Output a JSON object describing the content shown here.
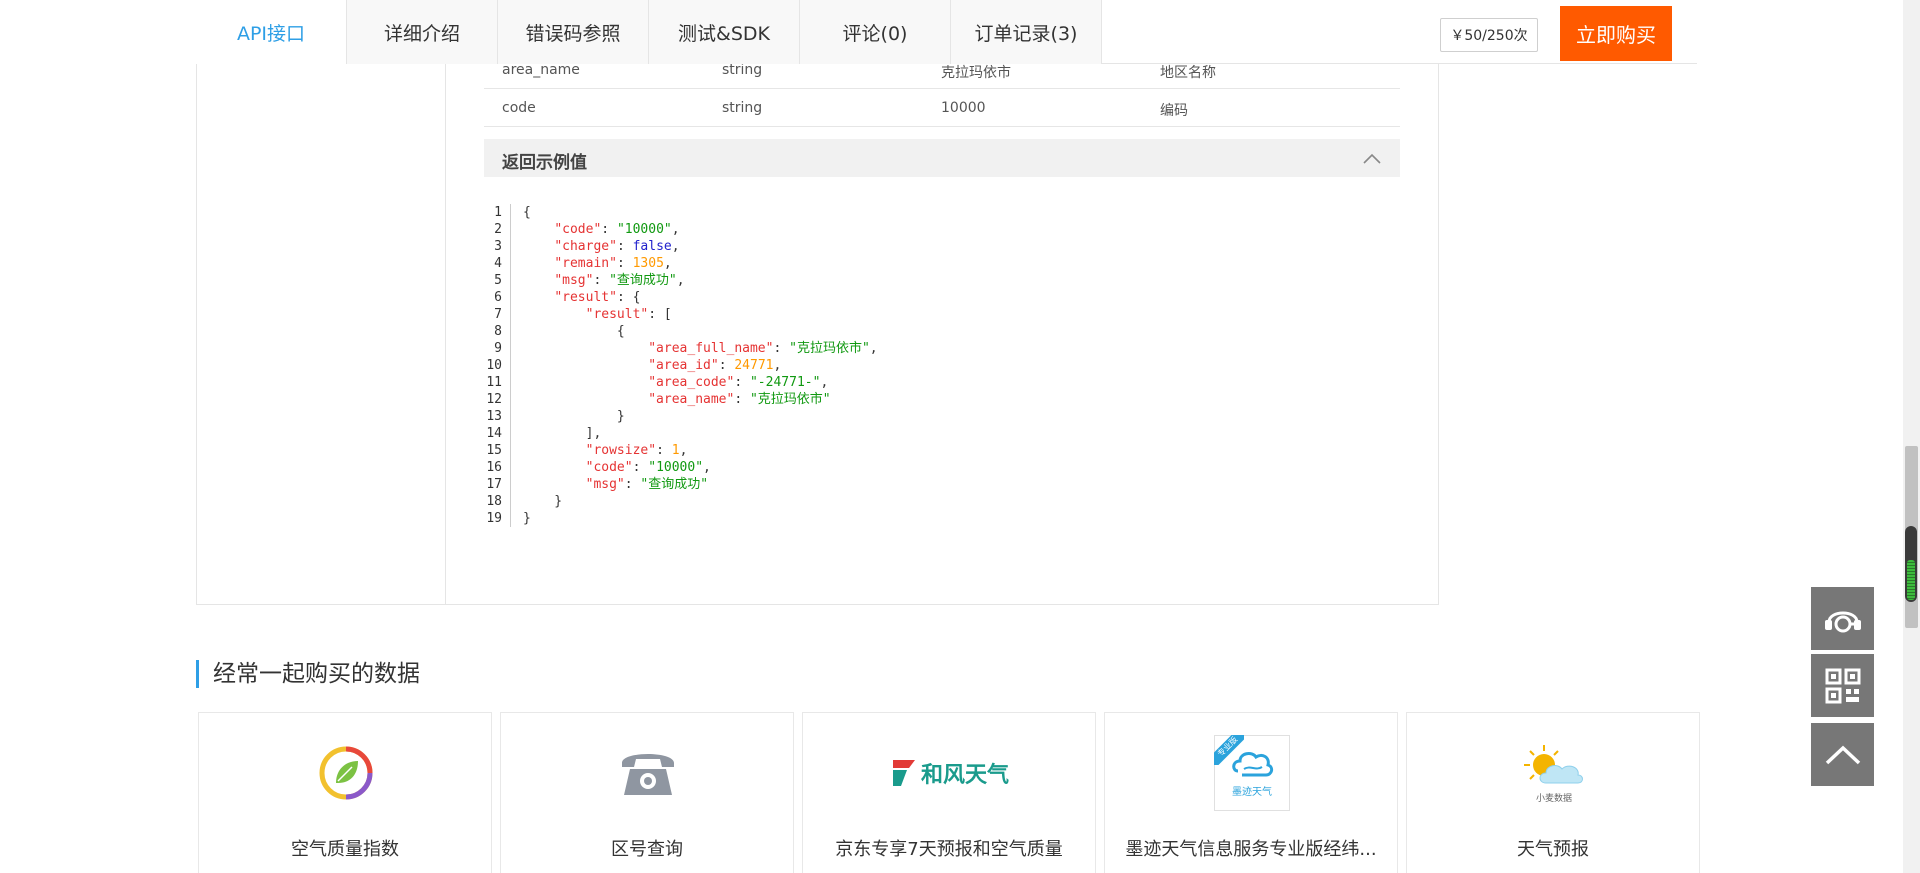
{
  "tabs": [
    {
      "label": "API接口",
      "active": true
    },
    {
      "label": "详细介绍",
      "active": false
    },
    {
      "label": "错误码参照",
      "active": false
    },
    {
      "label": "测试&SDK",
      "active": false
    },
    {
      "label": "评论(0)",
      "active": false
    },
    {
      "label": "订单记录(3)",
      "active": false
    }
  ],
  "price": "￥50/250次",
  "buy_button": "立即购买",
  "params": [
    {
      "name": "area_name",
      "type": "string",
      "example": "克拉玛依市",
      "desc": "地区名称"
    },
    {
      "name": "code",
      "type": "string",
      "example": "10000",
      "desc": "编码"
    }
  ],
  "example_section": {
    "title": "返回示例值",
    "icon": "chevron-up-icon"
  },
  "code_lines": [
    "{",
    "    \"code\": \"10000\",",
    "    \"charge\": false,",
    "    \"remain\": 1305,",
    "    \"msg\": \"查询成功\",",
    "    \"result\": {",
    "        \"result\": [",
    "            {",
    "                \"area_full_name\": \"克拉玛依市\",",
    "                \"area_id\": 24771,",
    "                \"area_code\": \"-24771-\",",
    "                \"area_name\": \"克拉玛依市\"",
    "            }",
    "        ],",
    "        \"rowsize\": 1,",
    "        \"code\": \"10000\",",
    "        \"msg\": \"查询成功\"",
    "    }",
    "}"
  ],
  "related": {
    "title": "经常一起购买的数据",
    "items": [
      {
        "label": "空气质量指数",
        "icon": "leaf-ring-icon"
      },
      {
        "label": "区号查询",
        "icon": "telephone-icon"
      },
      {
        "label": "京东专享7天预报和空气质量",
        "icon": "hefeng-weather-logo",
        "logo_text": "和风天气"
      },
      {
        "label": "墨迹天气信息服务专业版经纬...",
        "icon": "moji-weather-logo",
        "logo_text": "墨迹天气",
        "badge": "专业版"
      },
      {
        "label": "天气预报",
        "icon": "sun-cloud-icon",
        "logo_text": "小麦数据"
      }
    ]
  },
  "side_buttons": [
    {
      "icon": "customer-service-icon"
    },
    {
      "icon": "qr-code-icon"
    },
    {
      "icon": "back-to-top-icon"
    }
  ],
  "colors": {
    "accent": "#2e9fe6",
    "buy": "#ff5a00",
    "float": "#777777"
  }
}
